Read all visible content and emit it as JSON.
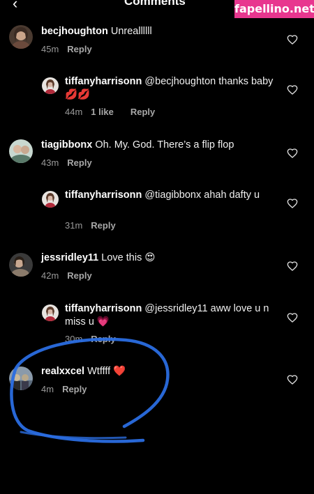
{
  "header": {
    "back_icon": "‹",
    "title": "Comments"
  },
  "watermark": "fapellino.net",
  "comments": [
    {
      "username": "becjhoughton",
      "text": "Unreallllll",
      "time": "45m",
      "reply_label": "Reply",
      "avatar_colors": [
        "#6b4a3c",
        "#c9a48a"
      ]
    },
    {
      "username": "tiffanyharrisonn",
      "text": "@becjhoughton thanks baby 💋💋",
      "time": "44m",
      "likes": "1 like",
      "reply_label": "Reply",
      "avatar_colors": [
        "#e8e4e0",
        "#b02a3a"
      ]
    },
    {
      "username": "tiagibbonx",
      "text": "Oh. My. God. There’s a flip flop",
      "time": "43m",
      "reply_label": "Reply",
      "avatar_colors": [
        "#c8d8d0",
        "#5a7a6a"
      ]
    },
    {
      "username": "tiffanyharrisonn",
      "text": "@tiagibbonx ahah dafty u",
      "time": "31m",
      "reply_label": "Reply",
      "avatar_colors": [
        "#e8e4e0",
        "#b02a3a"
      ]
    },
    {
      "username": "jessridley11",
      "text": "Love this 😍",
      "time": "42m",
      "reply_label": "Reply",
      "avatar_colors": [
        "#3a3a3a",
        "#8a7a6a"
      ]
    },
    {
      "username": "tiffanyharrisonn",
      "text": "@jessridley11 aww love u n miss u 💗",
      "time": "30m",
      "reply_label": "Reply",
      "avatar_colors": [
        "#e8e4e0",
        "#b02a3a"
      ]
    },
    {
      "username": "realxxcel",
      "text": "Wtffff ❤️",
      "time": "4m",
      "reply_label": "Reply",
      "avatar_colors": [
        "#5a6a7a",
        "#c8b89a"
      ]
    }
  ],
  "colors": {
    "background": "#000000",
    "secondary_text": "#9a9a9a",
    "annotation_stroke": "#2a6de0",
    "watermark_bg": "#e8368f"
  },
  "icons": {
    "heart": "heart-outline-icon",
    "back": "chevron-left-icon"
  }
}
